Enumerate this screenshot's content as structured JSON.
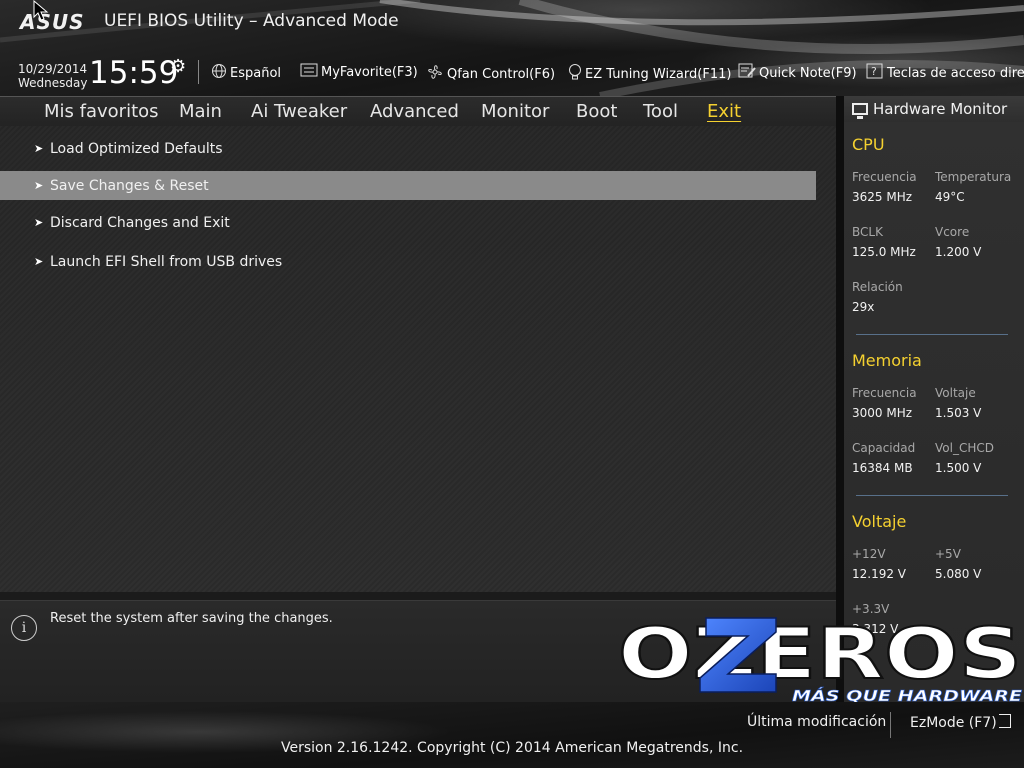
{
  "header": {
    "logo": "ASUS",
    "title": "UEFI BIOS Utility – Advanced Mode",
    "date": "10/29/2014",
    "weekday": "Wednesday",
    "time": "15:59"
  },
  "toolbar": {
    "language": "Español",
    "myfavorite": "MyFavorite(F3)",
    "qfan": "Qfan Control(F6)",
    "ez_tuning": "EZ Tuning Wizard(F11)",
    "quick_note": "Quick Note(F9)",
    "hotkeys": "Teclas de acceso directo"
  },
  "nav": {
    "tabs": [
      "Mis favoritos",
      "Main",
      "Ai Tweaker",
      "Advanced",
      "Monitor",
      "Boot",
      "Tool",
      "Exit"
    ],
    "active": "Exit"
  },
  "menu": {
    "items": [
      "Load Optimized Defaults",
      "Save Changes & Reset",
      "Discard Changes and Exit",
      "Launch EFI Shell from USB drives"
    ],
    "selected": "Save Changes & Reset"
  },
  "help": {
    "text": "Reset the system after saving the changes."
  },
  "hw_monitor": {
    "title": "Hardware Monitor",
    "cpu": {
      "title": "CPU",
      "freq_label": "Frecuencia",
      "freq_value": "3625 MHz",
      "temp_label": "Temperatura",
      "temp_value": "49°C",
      "bclk_label": "BCLK",
      "bclk_value": "125.0 MHz",
      "vcore_label": "Vcore",
      "vcore_value": "1.200 V",
      "ratio_label": "Relación",
      "ratio_value": "29x"
    },
    "memory": {
      "title": "Memoria",
      "freq_label": "Frecuencia",
      "freq_value": "3000 MHz",
      "volt_label": "Voltaje",
      "volt_value": "1.503 V",
      "cap_label": "Capacidad",
      "cap_value": "16384 MB",
      "vchcd_label": "Vol_CHCD",
      "vchcd_value": "1.500 V"
    },
    "voltage": {
      "title": "Voltaje",
      "v12_label": "+12V",
      "v12_value": "12.192 V",
      "v5_label": "+5V",
      "v5_value": "5.080 V",
      "v33_label": "+3.3V",
      "v33_value": "3.312 V"
    }
  },
  "watermark": {
    "brand": "OZEROS",
    "tagline": "MÁS QUE HARDWARE"
  },
  "footer": {
    "last_modified": "Última modificación",
    "ezmode": "EzMode (F7)",
    "copyright": "Version 2.16.1242. Copyright (C) 2014 American Megatrends, Inc."
  },
  "colors": {
    "accent_yellow": "#f5d130",
    "selected_row": "#8a8a8a",
    "watermark_blue": "#2a5fd0"
  }
}
